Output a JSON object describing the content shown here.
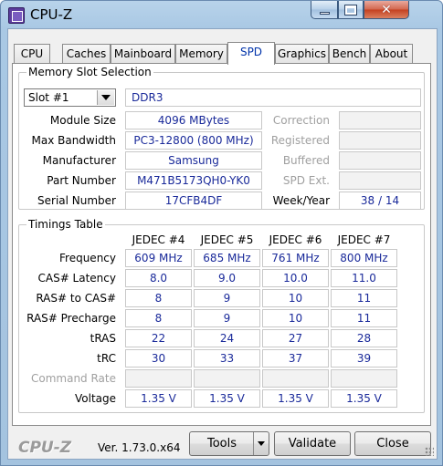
{
  "window": {
    "title": "CPU-Z",
    "close_glyph": "✕"
  },
  "tabs": [
    {
      "label": "CPU",
      "active": false
    },
    {
      "label": "Caches",
      "active": false
    },
    {
      "label": "Mainboard",
      "active": false
    },
    {
      "label": "Memory",
      "active": false
    },
    {
      "label": "SPD",
      "active": true
    },
    {
      "label": "Graphics",
      "active": false
    },
    {
      "label": "Bench",
      "active": false
    },
    {
      "label": "About",
      "active": false
    }
  ],
  "slot_selection": {
    "title": "Memory Slot Selection",
    "slot_value": "Slot #1",
    "memory_type": "DDR3",
    "left": [
      {
        "label": "Module Size",
        "value": "4096 MBytes"
      },
      {
        "label": "Max Bandwidth",
        "value": "PC3-12800 (800 MHz)"
      },
      {
        "label": "Manufacturer",
        "value": "Samsung"
      },
      {
        "label": "Part Number",
        "value": "M471B5173QH0-YK0"
      },
      {
        "label": "Serial Number",
        "value": "17CFB4DF"
      }
    ],
    "right": [
      {
        "label": "Correction",
        "value": ""
      },
      {
        "label": "Registered",
        "value": ""
      },
      {
        "label": "Buffered",
        "value": ""
      },
      {
        "label": "SPD Ext.",
        "value": ""
      },
      {
        "label": "Week/Year",
        "value": "38 / 14"
      }
    ]
  },
  "timings": {
    "title": "Timings Table",
    "columns": [
      "JEDEC #4",
      "JEDEC #5",
      "JEDEC #6",
      "JEDEC #7"
    ],
    "rows": [
      {
        "label": "Frequency",
        "values": [
          "609 MHz",
          "685 MHz",
          "761 MHz",
          "800 MHz"
        ]
      },
      {
        "label": "CAS# Latency",
        "values": [
          "8.0",
          "9.0",
          "10.0",
          "11.0"
        ]
      },
      {
        "label": "RAS# to CAS#",
        "values": [
          "8",
          "9",
          "10",
          "11"
        ]
      },
      {
        "label": "RAS# Precharge",
        "values": [
          "8",
          "9",
          "10",
          "11"
        ]
      },
      {
        "label": "tRAS",
        "values": [
          "22",
          "24",
          "27",
          "28"
        ]
      },
      {
        "label": "tRC",
        "values": [
          "30",
          "33",
          "37",
          "39"
        ]
      },
      {
        "label": "Command Rate",
        "values": [
          "",
          "",
          "",
          ""
        ]
      },
      {
        "label": "Voltage",
        "values": [
          "1.35 V",
          "1.35 V",
          "1.35 V",
          "1.35 V"
        ]
      }
    ]
  },
  "footer": {
    "logo": "CPU-Z",
    "version": "Ver. 1.73.0.x64",
    "tools_label": "Tools",
    "validate_label": "Validate",
    "close_label": "Close"
  }
}
